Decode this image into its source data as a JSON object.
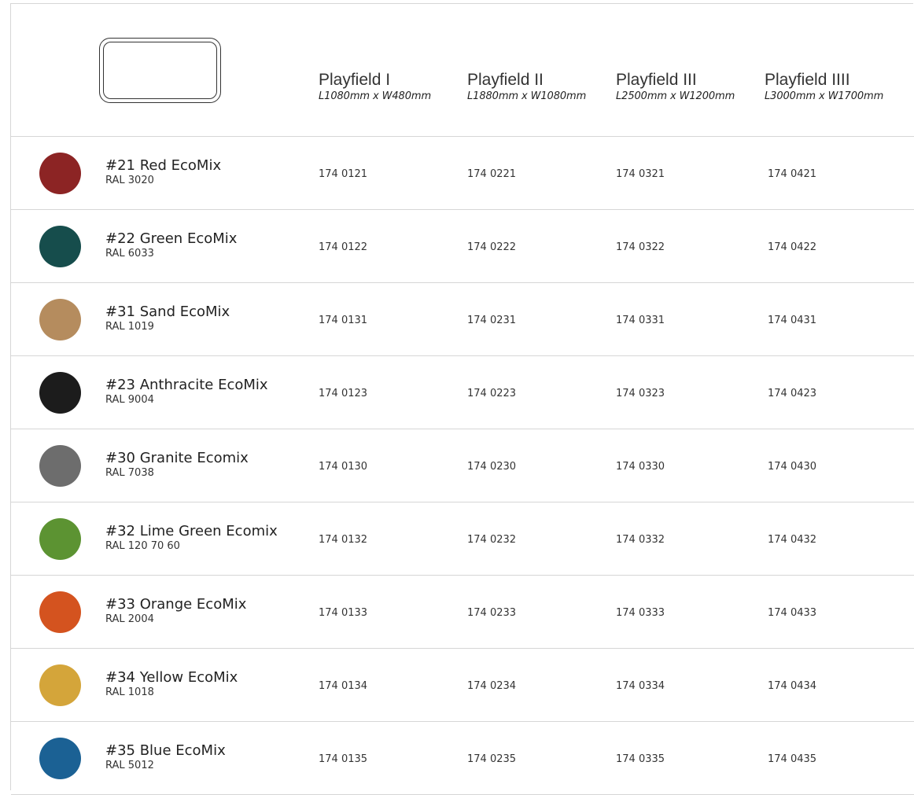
{
  "columns": [
    {
      "name": "Playfield I",
      "dims": "L1080mm x W480mm"
    },
    {
      "name": "Playfield II",
      "dims": "L1880mm x W1080mm"
    },
    {
      "name": "Playfield III",
      "dims": "L2500mm x W1200mm"
    },
    {
      "name": "Playfield IIII",
      "dims": "L3000mm x W1700mm"
    }
  ],
  "rows": [
    {
      "name": "#21 Red EcoMix",
      "ral": "RAL 3020",
      "color": "#8c2424",
      "codes": [
        "174 0121",
        "174 0221",
        "174 0321",
        "174 0421"
      ]
    },
    {
      "name": "#22 Green EcoMix",
      "ral": "RAL 6033",
      "color": "#164d4c",
      "codes": [
        "174 0122",
        "174 0222",
        "174 0322",
        "174 0422"
      ]
    },
    {
      "name": "#31 Sand EcoMix",
      "ral": "RAL 1019",
      "color": "#b58c5e",
      "codes": [
        "174 0131",
        "174 0231",
        "174 0331",
        "174 0431"
      ]
    },
    {
      "name": "#23 Anthracite EcoMix",
      "ral": "RAL 9004",
      "color": "#1c1c1c",
      "codes": [
        "174 0123",
        "174 0223",
        "174 0323",
        "174 0423"
      ]
    },
    {
      "name": "#30 Granite Ecomix",
      "ral": "RAL 7038",
      "color": "#6d6d6d",
      "codes": [
        "174 0130",
        "174 0230",
        "174 0330",
        "174 0430"
      ]
    },
    {
      "name": "#32 Lime Green Ecomix",
      "ral": "RAL 120 70 60",
      "color": "#5c9332",
      "codes": [
        "174 0132",
        "174 0232",
        "174 0332",
        "174 0432"
      ]
    },
    {
      "name": "#33 Orange EcoMix",
      "ral": "RAL 2004",
      "color": "#d4531f",
      "codes": [
        "174 0133",
        "174 0233",
        "174 0333",
        "174 0433"
      ]
    },
    {
      "name": "#34 Yellow EcoMix",
      "ral": "RAL 1018",
      "color": "#d4a53a",
      "codes": [
        "174 0134",
        "174 0234",
        "174 0334",
        "174 0434"
      ]
    },
    {
      "name": "#35 Blue EcoMix",
      "ral": "RAL 5012",
      "color": "#1b6194",
      "codes": [
        "174 0135",
        "174 0235",
        "174 0335",
        "174 0435"
      ]
    }
  ]
}
